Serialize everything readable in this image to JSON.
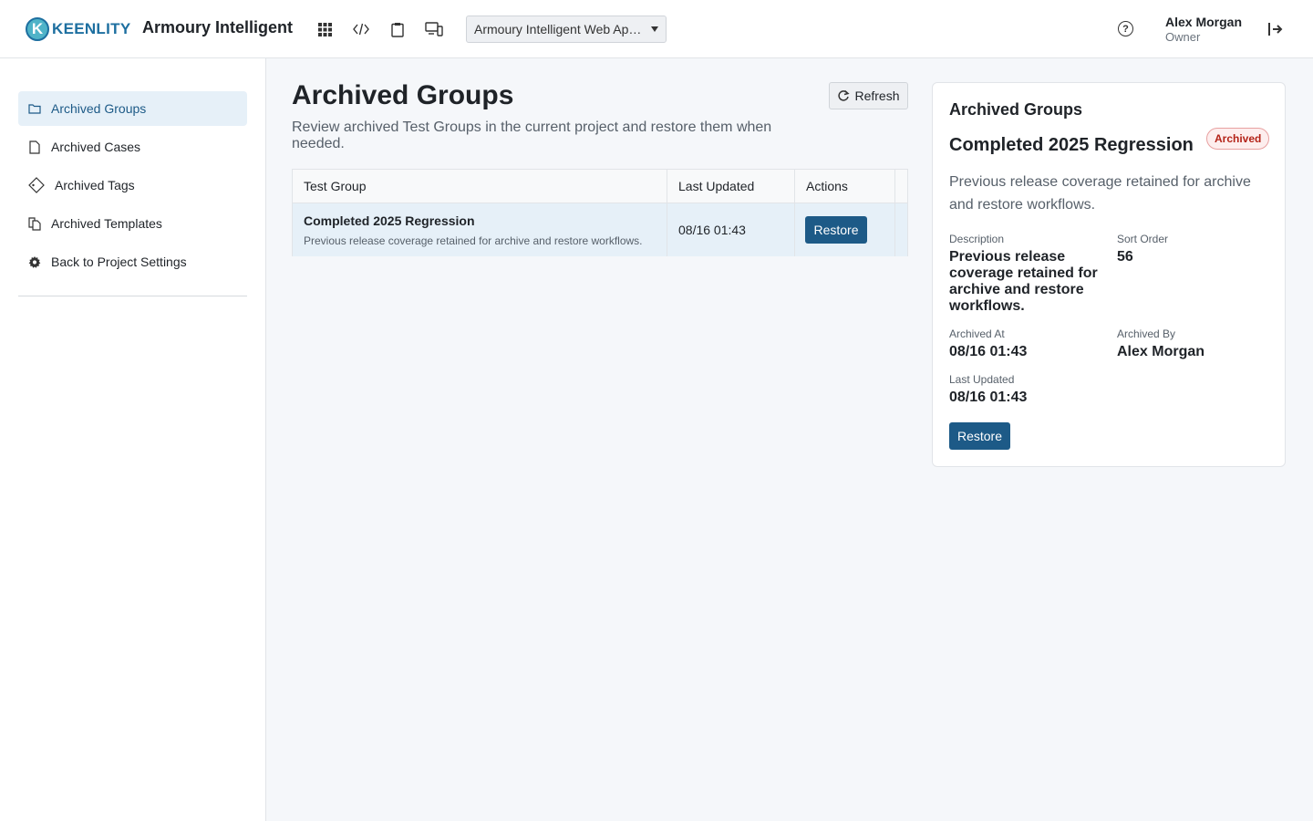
{
  "header": {
    "logo_letter": "K",
    "logo_text": "KEENLITY",
    "app_title": "Armoury Intelligent",
    "project_select": "Armoury Intelligent Web Application",
    "user_name": "Alex Morgan",
    "user_role": "Owner",
    "help_glyph": "?"
  },
  "sidebar": {
    "items": [
      {
        "label": "Archived Groups",
        "icon": "folder-icon",
        "active": true
      },
      {
        "label": "Archived Cases",
        "icon": "file-icon",
        "active": false
      },
      {
        "label": "Archived Tags",
        "icon": "tag-icon",
        "active": false
      },
      {
        "label": "Archived Templates",
        "icon": "copy-icon",
        "active": false
      },
      {
        "label": "Back to Project Settings",
        "icon": "gear-icon",
        "active": false
      }
    ]
  },
  "main": {
    "title": "Archived Groups",
    "subtitle": "Review archived Test Groups in the current project and restore them when needed.",
    "refresh_label": "Refresh",
    "table": {
      "columns": [
        "Test Group",
        "Last Updated",
        "Actions"
      ],
      "rows": [
        {
          "name": "Completed 2025 Regression",
          "description": "Previous release coverage retained for archive and restore workflows.",
          "last_updated": "08/16 01:43",
          "action": "Restore"
        }
      ]
    }
  },
  "detail": {
    "heading": "Archived Groups",
    "title": "Completed 2025 Regression",
    "badge": "Archived",
    "summary": "Previous release coverage retained for archive and restore workflows.",
    "description_label": "Description",
    "description_value": "Previous release coverage retained for archive and restore workflows.",
    "sort_order_label": "Sort Order",
    "sort_order_value": "56",
    "archived_at_label": "Archived At",
    "archived_at_value": "08/16 01:43",
    "archived_by_label": "Archived By",
    "archived_by_value": "Alex Morgan",
    "last_updated_label": "Last Updated",
    "last_updated_value": "08/16 01:43",
    "restore_label": "Restore"
  },
  "colors": {
    "accent": "#1d5a87",
    "active_bg": "#e6f0f8",
    "badge_red": "#b42318"
  }
}
